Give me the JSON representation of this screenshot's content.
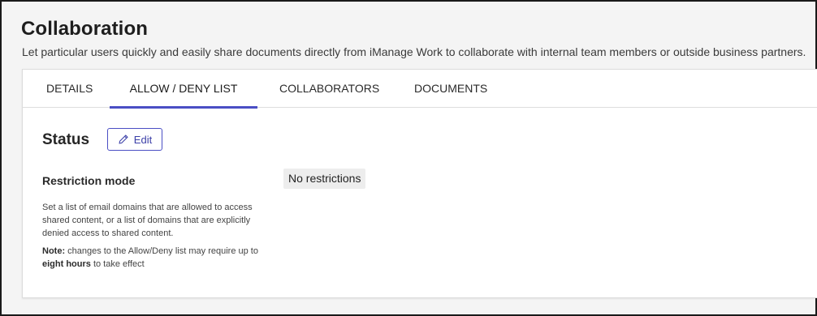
{
  "header": {
    "title": "Collaboration",
    "subtitle": "Let particular users quickly and easily share documents directly from iManage Work to collaborate with internal team members or outside business partners."
  },
  "tabs": [
    {
      "label": "DETAILS",
      "active": false
    },
    {
      "label": "ALLOW / DENY LIST",
      "active": true
    },
    {
      "label": "COLLABORATORS",
      "active": false
    },
    {
      "label": "DOCUMENTS",
      "active": false
    }
  ],
  "status": {
    "title": "Status",
    "edit_label": "Edit"
  },
  "restriction": {
    "label": "Restriction mode",
    "value": "No restrictions",
    "help_text": "Set a list of email domains that are allowed to access shared content, or a list of domains that are explicitly denied access to shared content.",
    "note_label": "Note:",
    "note_text_1": " changes to the Allow/Deny list may require up to ",
    "note_bold": "eight hours",
    "note_text_2": " to take effect"
  },
  "colors": {
    "accent": "#4a4ec4",
    "background": "#f4f4f4",
    "card": "#ffffff",
    "chip": "#ededed"
  },
  "icons": {
    "edit": "pencil-icon"
  }
}
